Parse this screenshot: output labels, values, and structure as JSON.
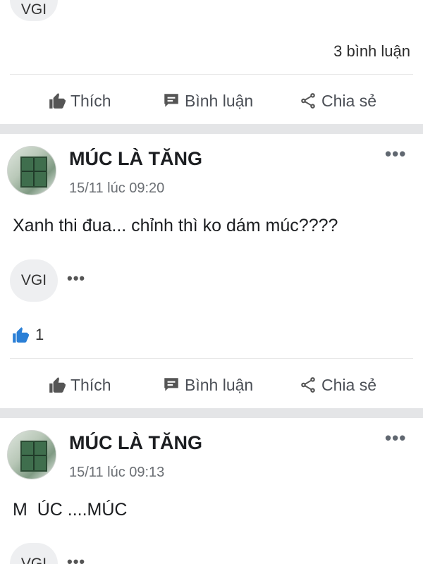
{
  "top_card": {
    "reactor_label": "VGI",
    "comment_count": "3 bình luận"
  },
  "actions": {
    "like": "Thích",
    "comment": "Bình luận",
    "share": "Chia sẻ"
  },
  "posts": [
    {
      "author": "MÚC LÀ TĂNG",
      "time": "15/11 lúc 09:20",
      "text": "Xanh thi đua... chỉnh thì ko dám múc????",
      "reactor_label": "VGI",
      "like_count": "1"
    },
    {
      "author": "MÚC LÀ TĂNG",
      "time": "15/11 lúc 09:13",
      "text": "M  ÚC ....MÚC",
      "reactor_label": "VGI"
    }
  ],
  "icons": {
    "more": "more-dots-icon",
    "like": "thumbs-up-icon",
    "comment": "comment-bubble-icon",
    "share": "share-icon"
  },
  "colors": {
    "like_blue": "#2a7fd6",
    "separator": "#e4e5e7",
    "pill_bg": "#eeeff1"
  }
}
